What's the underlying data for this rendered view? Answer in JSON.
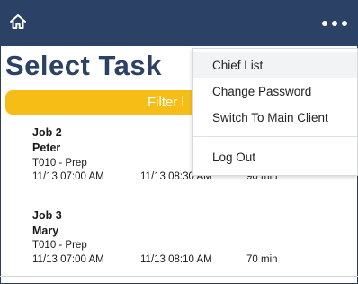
{
  "header": {
    "home_icon": "home-icon",
    "more_icon": "more-horizontal-icon",
    "background_color": "#2b4266"
  },
  "page": {
    "title": "Select Task"
  },
  "filter": {
    "label": "Filter l",
    "color": "#f6bd16"
  },
  "jobs": [
    {
      "title": "Job 2",
      "worker": "Peter",
      "code": "T010 - Prep",
      "start": "11/13 07:00 AM",
      "end": "11/13 08:30 AM",
      "duration": "90 min"
    },
    {
      "title": "Job 3",
      "worker": "Mary",
      "code": "T010 - Prep",
      "start": "11/13 07:00 AM",
      "end": "11/13 08:10 AM",
      "duration": "70 min"
    }
  ],
  "menu": {
    "items": [
      {
        "label": "Chief List"
      },
      {
        "label": "Change Password"
      },
      {
        "label": "Switch To Main Client"
      },
      {
        "label": "Log Out"
      }
    ]
  }
}
